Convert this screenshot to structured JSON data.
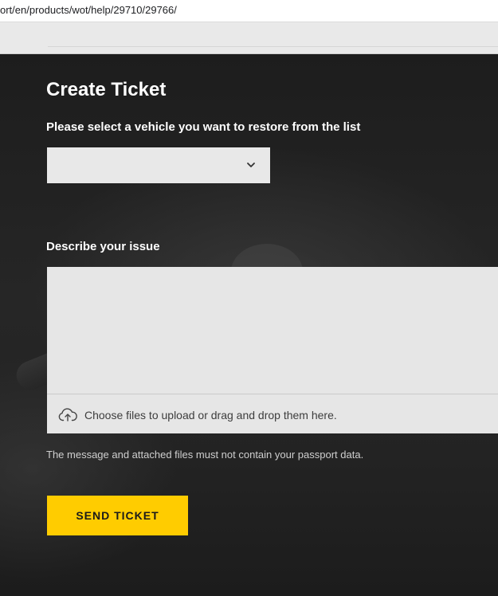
{
  "browser": {
    "url": "ort/en/products/wot/help/29710/29766/"
  },
  "form": {
    "title": "Create Ticket",
    "vehicle_label": "Please select a vehicle you want to restore from the list",
    "vehicle_select": {
      "value": "",
      "icon": "chevron-down-icon"
    },
    "describe_label": "Describe your issue",
    "issue_text": {
      "value": "",
      "placeholder": ""
    },
    "upload": {
      "icon": "cloud-upload-icon",
      "text": "Choose files to upload or drag and drop them here."
    },
    "disclaimer": "The message and attached files must not contain your passport data.",
    "send_button": "SEND TICKET"
  },
  "colors": {
    "accent": "#ffcc00",
    "background": "#1f1f1f",
    "field": "#e8e8e8"
  }
}
